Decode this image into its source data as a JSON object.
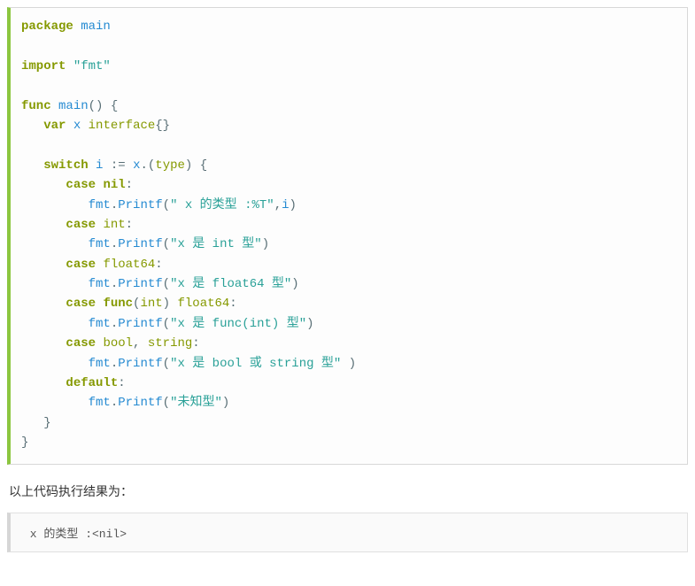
{
  "code": {
    "line1_kw": "package",
    "line1_id": "main",
    "line3_kw": "import",
    "line3_str": "\"fmt\"",
    "line5_kw": "func",
    "line5_id": "main",
    "line6_kw": "var",
    "line6_id": "x",
    "line6_type": "interface",
    "line8_kw": "switch",
    "line8_i": "i",
    "line8_x": "x",
    "line8_type": "type",
    "line9_kw": "case",
    "line9_nil": "nil",
    "line10_fmt": "fmt",
    "line10_printf": "Printf",
    "line10_str": "\" x 的类型 :%T\"",
    "line10_i": "i",
    "line11_kw": "case",
    "line11_int": "int",
    "line12_fmt": "fmt",
    "line12_printf": "Printf",
    "line12_str": "\"x 是 int 型\"",
    "line13_kw": "case",
    "line13_type": "float64",
    "line14_fmt": "fmt",
    "line14_printf": "Printf",
    "line14_str": "\"x 是 float64 型\"",
    "line15_kw": "case",
    "line15_func": "func",
    "line15_int": "int",
    "line15_float": "float64",
    "line16_fmt": "fmt",
    "line16_printf": "Printf",
    "line16_str": "\"x 是 func(int) 型\"",
    "line17_kw": "case",
    "line17_bool": "bool",
    "line17_string": "string",
    "line18_fmt": "fmt",
    "line18_printf": "Printf",
    "line18_str": "\"x 是 bool 或 string 型\"",
    "line19_kw": "default",
    "line20_fmt": "fmt",
    "line20_printf": "Printf",
    "line20_str": "\"未知型\""
  },
  "desc": "以上代码执行结果为：",
  "output": " x 的类型 :<nil>"
}
